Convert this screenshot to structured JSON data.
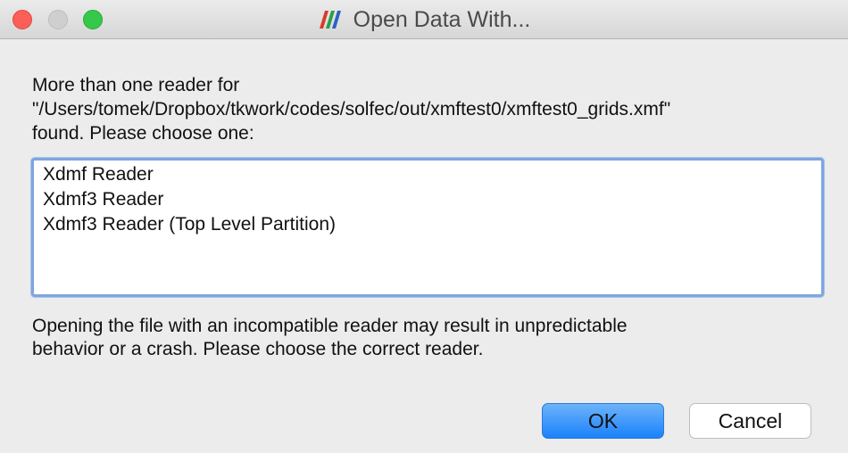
{
  "window": {
    "title": "Open Data With..."
  },
  "prompt": {
    "line1": "More than one reader for",
    "line2": "\"/Users/tomek/Dropbox/tkwork/codes/solfec/out/xmftest0/xmftest0_grids.xmf\"",
    "line3": "found.  Please choose one:"
  },
  "readers": {
    "items": [
      {
        "label": "Xdmf Reader"
      },
      {
        "label": "Xdmf3 Reader"
      },
      {
        "label": "Xdmf3 Reader (Top Level Partition)"
      }
    ]
  },
  "warning": {
    "line1": "Opening the file with an incompatible reader may result in unpredictable",
    "line2": "behavior or a crash.  Please choose the correct reader."
  },
  "buttons": {
    "ok_label": "OK",
    "cancel_label": "Cancel"
  },
  "colors": {
    "accent": "#1a82fb",
    "close": "#fc5f57",
    "zoom": "#35c94a",
    "focus_ring": "#7ea6e0"
  }
}
